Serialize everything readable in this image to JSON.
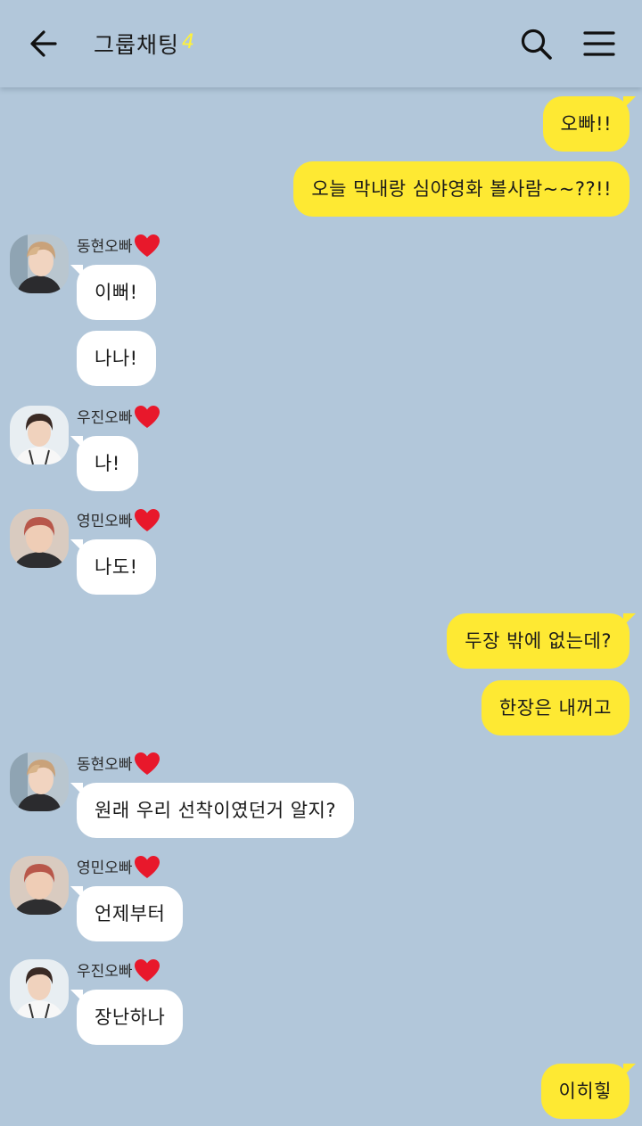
{
  "header": {
    "title": "그룹채팅",
    "member_count": "4"
  },
  "messages": [
    {
      "from": "me",
      "text": "오빠!!"
    },
    {
      "from": "me",
      "text": "오늘 막내랑 심야영화 볼사람~~??!!"
    },
    {
      "from": "동현오빠",
      "text": "이뻐!"
    },
    {
      "from": "동현오빠",
      "text": "나나!"
    },
    {
      "from": "우진오빠",
      "text": "나!"
    },
    {
      "from": "영민오빠",
      "text": "나도!"
    },
    {
      "from": "me",
      "text": "두장 밖에 없는데?"
    },
    {
      "from": "me",
      "text": "한장은 내꺼고"
    },
    {
      "from": "동현오빠",
      "text": "원래 우리 선착이였던거 알지?"
    },
    {
      "from": "영민오빠",
      "text": "언제부터"
    },
    {
      "from": "우진오빠",
      "text": "장난하나"
    },
    {
      "from": "me",
      "text": "이히힣"
    }
  ],
  "senders": {
    "donghyun": "동현오빠",
    "woojin": "우진오빠",
    "youngmin": "영민오빠"
  },
  "colors": {
    "background": "#b2c7da",
    "my_bubble": "#fee933",
    "other_bubble": "#ffffff",
    "count_accent": "#fff23a",
    "heart": "#e8182b"
  },
  "icons": {
    "back": "arrow-left-icon",
    "search": "search-icon",
    "menu": "hamburger-menu-icon",
    "heart": "red-heart-icon"
  }
}
